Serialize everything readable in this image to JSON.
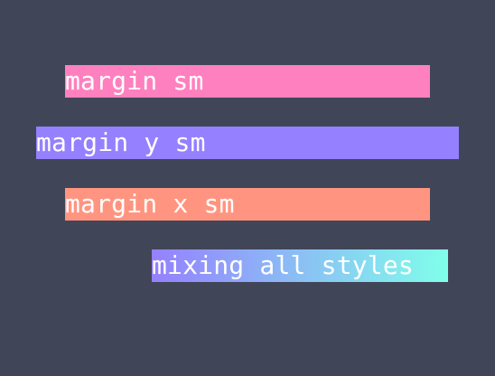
{
  "colors": {
    "background": "#414558",
    "pink": "#ff80bf",
    "purple": "#9580ff",
    "salmon": "#ff9580",
    "cyan": "#80ffea",
    "text": "#ffffff"
  },
  "items": [
    {
      "label": "margin sm"
    },
    {
      "label": "margin y sm"
    },
    {
      "label": "margin x sm"
    },
    {
      "label": "mixing all styles"
    }
  ]
}
